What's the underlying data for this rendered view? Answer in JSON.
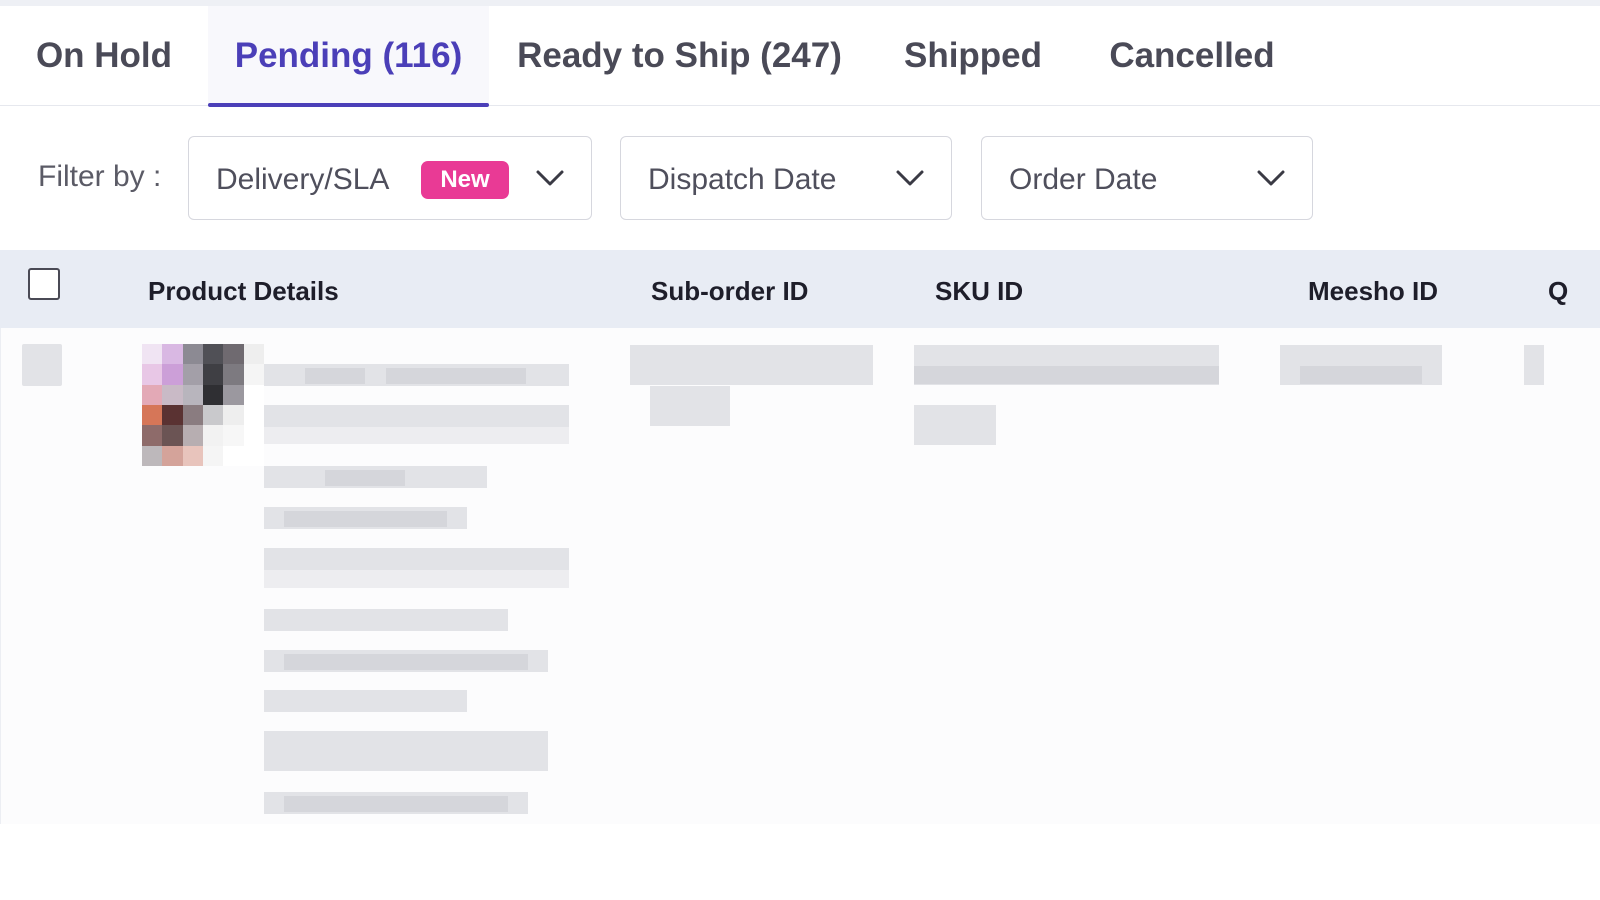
{
  "tabs": [
    {
      "label": "On Hold",
      "active": false
    },
    {
      "label": "Pending (116)",
      "active": true
    },
    {
      "label": "Ready to Ship (247)",
      "active": false
    },
    {
      "label": "Shipped",
      "active": false
    },
    {
      "label": "Cancelled",
      "active": false
    }
  ],
  "filters": {
    "label": "Filter by :",
    "delivery_sla": {
      "label": "Delivery/SLA",
      "badge": "New"
    },
    "dispatch_date": {
      "label": "Dispatch Date"
    },
    "order_date": {
      "label": "Order Date"
    }
  },
  "table": {
    "columns": [
      "Product Details",
      "Sub-order ID",
      "SKU ID",
      "Meesho ID",
      "Q"
    ]
  },
  "colors": {
    "accent": "#4b3fb8",
    "badge": "#e93a95",
    "header_bg": "#e8ecf4"
  },
  "icons": {
    "dropdown": "chevron-down-icon",
    "select_all": "checkbox-icon"
  }
}
